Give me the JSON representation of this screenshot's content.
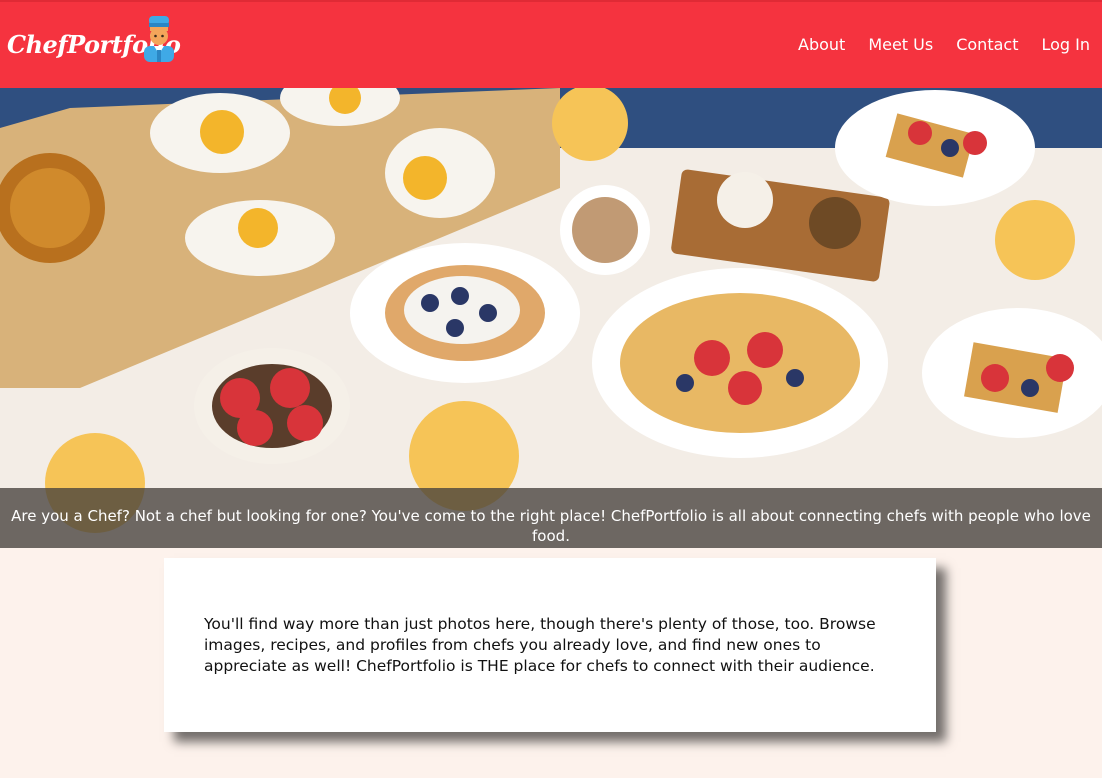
{
  "header": {
    "logo_text": "ChefPortfolio",
    "nav": [
      {
        "label": "About"
      },
      {
        "label": "Meet Us"
      },
      {
        "label": "Contact"
      },
      {
        "label": "Log In"
      }
    ]
  },
  "hero": {
    "caption": "Are you a Chef? Not a chef but looking for one? You've come to the right place! ChefPortfolio is all about connecting chefs with people who love food."
  },
  "intro": {
    "text": "You'll find way more than just photos here, though there's plenty of those, too. Browse images, recipes, and profiles from chefs you already love, and find new ones to appreciate as well! ChefPortfolio is THE place for chefs to connect with their audience."
  },
  "colors": {
    "header_bg": "#f5333f",
    "page_bg": "#fdf2ec",
    "card_bg": "#ffffff"
  },
  "icons": {
    "logo_icon": "chef-avatar-icon"
  }
}
